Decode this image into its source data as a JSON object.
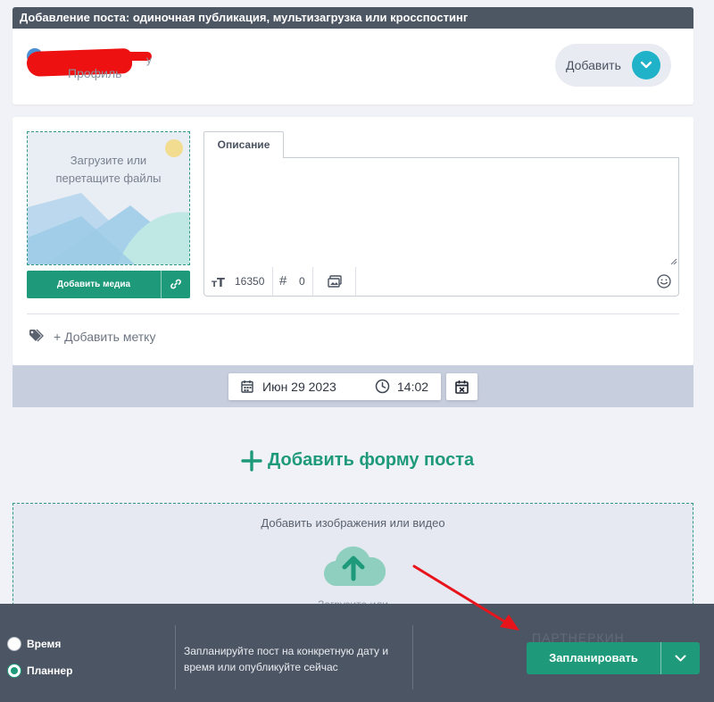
{
  "header": {
    "title": "Добавление поста: одиночная публикация, мультизагрузка или кросспостинг"
  },
  "profile": {
    "name_tail": "y",
    "label": "Профиль"
  },
  "add_button": {
    "label": "Добавить"
  },
  "uploader": {
    "line1": "Загрузите или",
    "line2": "перетащите файлы"
  },
  "add_media": {
    "label": "Добавить медиа"
  },
  "description": {
    "tab_label": "Описание",
    "value": "",
    "char_count": "16350",
    "hashtag_count": "0"
  },
  "tags": {
    "add_label": "+ Добавить метку"
  },
  "schedule": {
    "date": "Июн 29 2023",
    "time": "14:02"
  },
  "add_form": {
    "label": "Добавить форму поста"
  },
  "drop_zone": {
    "title": "Добавить изображения или видео",
    "subtitle": "Загрузите или"
  },
  "bottom_bar": {
    "radio_time_label": "Время",
    "radio_planner_label": "Планнер",
    "selected_mode": "Планнер",
    "hint": "Запланируйте пост на конкретную дату и время или опубликуйте сейчас",
    "watermark": "ПАРТНЕРКИН",
    "schedule_label": "Запланировать"
  },
  "colors": {
    "accent": "#1e9a7b",
    "header_bg": "#4d5764",
    "bar_bg": "#4c5563",
    "teal_circle": "#1fb2c8",
    "arrow": "#e8141c"
  }
}
